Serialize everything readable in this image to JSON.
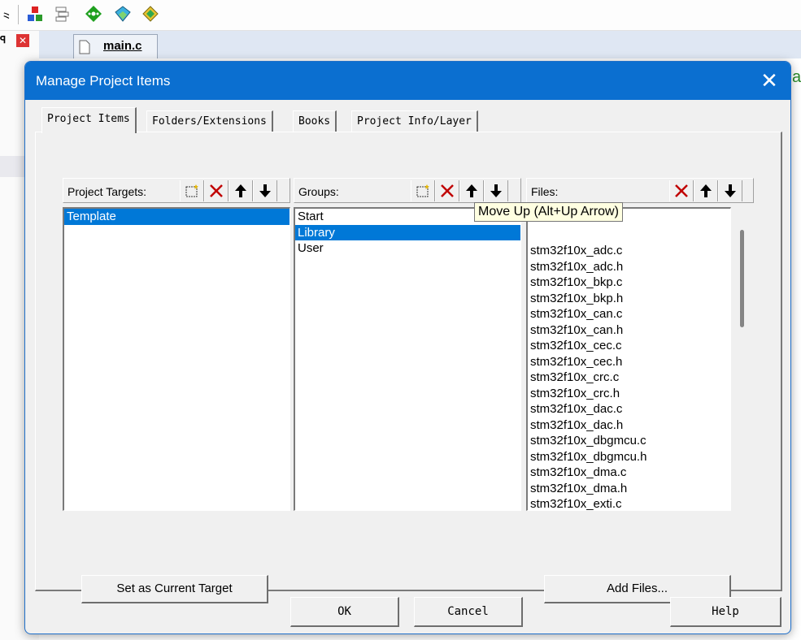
{
  "ide": {
    "document_tab": "main.c",
    "background_char": "a",
    "toolbar_icons": [
      "translate-icon",
      "manage-components-icon",
      "window-stack-icon",
      "pack-installer-icon",
      "select-software-packs-icon",
      "run-time-environment-icon"
    ]
  },
  "dialog": {
    "title": "Manage Project Items",
    "tabs": [
      {
        "label": "Project Items",
        "active": true
      },
      {
        "label": "Folders/Extensions",
        "active": false
      },
      {
        "label": "Books",
        "active": false
      },
      {
        "label": "Project Info/Layer",
        "active": false
      }
    ],
    "targets": {
      "label": "Project Targets:",
      "items": [
        "Template"
      ],
      "selected": "Template",
      "button": "Set as Current Target"
    },
    "groups": {
      "label": "Groups:",
      "items": [
        "Start",
        "Library",
        "User"
      ],
      "selected": "Library"
    },
    "files": {
      "label": "Files:",
      "items": [
        "stm32f10x_adc.c",
        "stm32f10x_adc.h",
        "stm32f10x_bkp.c",
        "stm32f10x_bkp.h",
        "stm32f10x_can.c",
        "stm32f10x_can.h",
        "stm32f10x_cec.c",
        "stm32f10x_cec.h",
        "stm32f10x_crc.c",
        "stm32f10x_crc.h",
        "stm32f10x_dac.c",
        "stm32f10x_dac.h",
        "stm32f10x_dbgmcu.c",
        "stm32f10x_dbgmcu.h",
        "stm32f10x_dma.c",
        "stm32f10x_dma.h",
        "stm32f10x_exti.c"
      ],
      "button": "Add Files..."
    },
    "tooltip": "Move Up (Alt+Up Arrow)",
    "buttons": {
      "ok": "OK",
      "cancel": "Cancel",
      "help": "Help"
    }
  },
  "colors": {
    "title_bar": "#0b6fd0",
    "selection": "#0078d7",
    "tooltip_bg": "#ffffe1",
    "delete_red": "#c00000"
  }
}
